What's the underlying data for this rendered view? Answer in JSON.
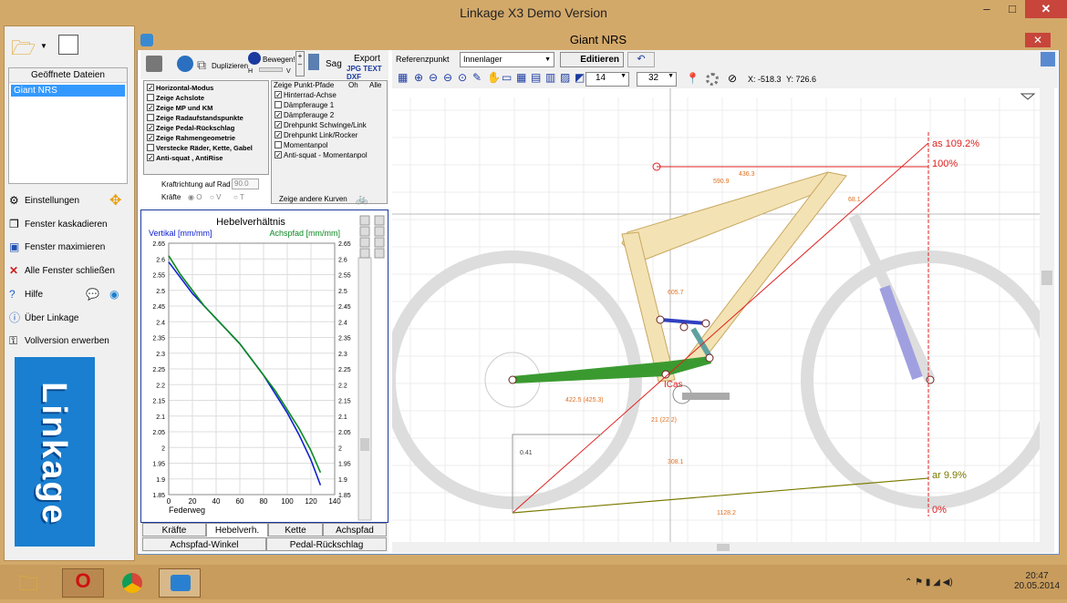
{
  "app": {
    "title": "Linkage X3 Demo Version",
    "min": "–",
    "max": "□",
    "close": "✕"
  },
  "left": {
    "files_header": "Geöffnete Dateien",
    "files": [
      "Giant NRS"
    ],
    "menu": [
      "Einstellungen",
      "Fenster kaskadieren",
      "Fenster maximieren",
      "Alle Fenster schließen",
      "Hilfe",
      "Über Linkage",
      "Vollversion erwerben"
    ],
    "logo": "Linkage"
  },
  "child": {
    "title": "Giant NRS",
    "close": "✕"
  },
  "toolbar": {
    "duplizieren": "Duplizieren",
    "bewegen": "Bewegen!",
    "h": "H",
    "v": "V",
    "sag": "Sag",
    "export": "Export",
    "export_fmt": "JPG TEXT DXF"
  },
  "checks_left": [
    {
      "label": "Horizontal-Modus",
      "on": true
    },
    {
      "label": "Zeige Achslote",
      "on": false
    },
    {
      "label": "Zeige MP und KM",
      "on": true
    },
    {
      "label": "Zeige Radaufstandspunkte",
      "on": false
    },
    {
      "label": "Zeige Pedal-Rückschlag",
      "on": true
    },
    {
      "label": "Zeige Rahmengeometrie",
      "on": true
    },
    {
      "label": "Verstecke Räder, Kette, Gabel",
      "on": false
    },
    {
      "label": "Anti-squat , AntiRise",
      "on": true
    }
  ],
  "paths": {
    "header": "Zeige Punkt-Pfade",
    "oh": "Oh",
    "alle": "Alle",
    "other": "Zeige andere Kurven",
    "items": [
      {
        "label": "Hinterrad-Achse",
        "on": true
      },
      {
        "label": "Dämpferauge 1",
        "on": false
      },
      {
        "label": "Dämpferauge 2",
        "on": true
      },
      {
        "label": "Drehpunkt Schwinge/Link",
        "on": true
      },
      {
        "label": "Drehpunkt Link/Rocker",
        "on": true
      },
      {
        "label": "Momentanpol",
        "on": false
      },
      {
        "label": "Anti-squat - Momentanpol",
        "on": true
      }
    ]
  },
  "kraft": {
    "label": "Kraftrichtung auf Rad",
    "value": "90.0",
    "kraefte": "Kräfte",
    "o": "O",
    "v": "V",
    "t": "T"
  },
  "chart_data": {
    "type": "line",
    "title": "Hebelverhältnis",
    "ylabel_left": "Vertikal [mm/mm]",
    "ylabel_right": "Achspfad [mm/mm]",
    "xlabel": "Federweg",
    "xlim": [
      0,
      140
    ],
    "ylim": [
      1.85,
      2.65
    ],
    "x_ticks": [
      "0",
      "20",
      "40",
      "60",
      "80",
      "100",
      "120",
      "140"
    ],
    "y_ticks": [
      "2.65",
      "2.6",
      "2.55",
      "2.5",
      "2.45",
      "2.4",
      "2.35",
      "2.3",
      "2.25",
      "2.2",
      "2.15",
      "2.1",
      "2.05",
      "2",
      "1.95",
      "1.9",
      "1.85"
    ],
    "series": [
      {
        "color": "#1020d0",
        "x": [
          0,
          10,
          20,
          30,
          40,
          50,
          60,
          70,
          80,
          90,
          100,
          110,
          120,
          128
        ],
        "y": [
          2.59,
          2.54,
          2.49,
          2.45,
          2.41,
          2.37,
          2.33,
          2.28,
          2.23,
          2.17,
          2.11,
          2.04,
          1.96,
          1.88
        ]
      },
      {
        "color": "#0a8a20",
        "x": [
          0,
          10,
          20,
          30,
          40,
          50,
          60,
          70,
          80,
          90,
          100,
          110,
          120,
          128
        ],
        "y": [
          2.61,
          2.55,
          2.5,
          2.45,
          2.41,
          2.37,
          2.33,
          2.28,
          2.23,
          2.18,
          2.12,
          2.06,
          1.99,
          1.92
        ]
      }
    ]
  },
  "tabs": {
    "row1": [
      "Kräfte",
      "Hebelverh.",
      "Kette",
      "Achspfad"
    ],
    "row2": [
      "Achspfad-Winkel",
      "Pedal-Rückschlag"
    ]
  },
  "main": {
    "ref_label": "Referenzpunkt",
    "ref_value": "Innenlager",
    "edit": "Editieren",
    "sel1": "14",
    "sel2": "32",
    "coord_x": "X: -518.3",
    "coord_y": "Y: 726.6"
  },
  "drawing": {
    "as_label": "as 109.2%",
    "p100": "100%",
    "ar_label": "ar 9.9%",
    "p0": "0%",
    "ic": "ICas",
    "dims": [
      "436.3",
      "590.9",
      "68.1",
      "605.7",
      "422.5 (425.3)",
      "21 (22.2)",
      "0.41",
      "308.1",
      "1128.2"
    ]
  },
  "taskbar": {
    "time": "20:47",
    "date": "20.05.2014"
  },
  "colors": {
    "title": "#d3a96a",
    "accent": "#3399ff",
    "frame": "#f3e2b4",
    "swing": "#3a9a30",
    "red": "#e02020",
    "olive": "#7a7a00"
  }
}
